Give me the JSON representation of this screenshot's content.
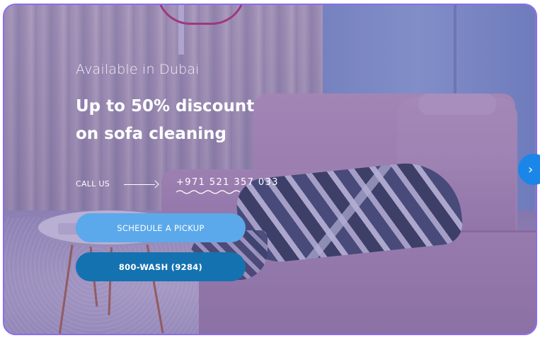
{
  "hero": {
    "tagline": "Available in Dubai",
    "headline_line1": "Up to 50% discount",
    "headline_line2": "on sofa cleaning",
    "call_label": "CALL US",
    "phone": "+971 521 357 033",
    "primary_button": "SCHEDULE A PICKUP",
    "secondary_button": "800-WASH (9284)"
  },
  "slider": {
    "next_glyph": "›"
  },
  "colors": {
    "frame_border": "#8b6cf0",
    "primary_button": "#5ba9ea",
    "secondary_button": "#1572b0",
    "next_button": "#1a86e8",
    "text": "#ffffff"
  },
  "icons": {
    "arrow": "arrow-right-icon",
    "underline": "wave-underline-icon",
    "next": "chevron-right-icon"
  }
}
